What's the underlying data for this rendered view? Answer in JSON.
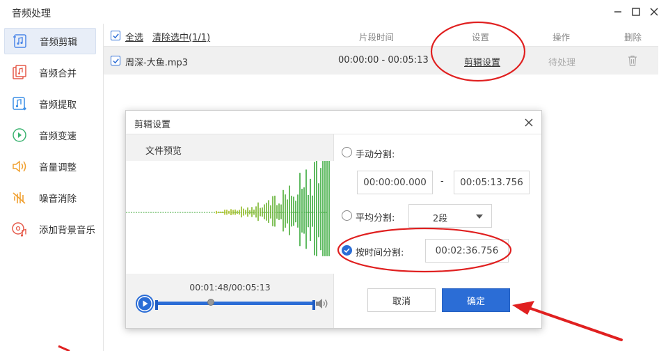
{
  "window": {
    "title": "音频处理"
  },
  "sidebar": {
    "items": [
      {
        "label": "音频剪辑",
        "icon": "audio-cut-icon",
        "active": true
      },
      {
        "label": "音频合并",
        "icon": "audio-merge-icon"
      },
      {
        "label": "音频提取",
        "icon": "audio-extract-icon"
      },
      {
        "label": "音频变速",
        "icon": "audio-speed-icon"
      },
      {
        "label": "音量调整",
        "icon": "volume-adjust-icon"
      },
      {
        "label": "噪音消除",
        "icon": "noise-remove-icon"
      },
      {
        "label": "添加背景音乐",
        "icon": "add-bgm-icon"
      }
    ]
  },
  "table": {
    "select_all": "全选",
    "clear_selected": "清除选中(1/1)",
    "col_segment_time": "片段时间",
    "col_settings": "设置",
    "col_action": "操作",
    "col_delete": "删除",
    "row": {
      "file": "周深-大鱼.mp3",
      "segment_time": "00:00:00 - 00:05:13",
      "settings_link": "剪辑设置",
      "status": "待处理"
    }
  },
  "dialog": {
    "title": "剪辑设置",
    "preview_label": "文件预览",
    "playback_time": "00:01:48/00:05:13",
    "progress_fraction": 0.34,
    "options": {
      "manual_label": "手动分割:",
      "manual_start": "00:00:00.000",
      "range_separator": "-",
      "manual_end": "00:05:13.756",
      "average_label": "平均分割:",
      "average_value": "2段",
      "by_time_label": "按时间分割:",
      "by_time_value": "00:02:36.756"
    },
    "cancel_label": "取消",
    "ok_label": "确定"
  },
  "colors": {
    "accent": "#2b6dd6",
    "annotation_red": "#e02020",
    "wave_green": "#3fa83a",
    "wave_yellow": "#b9c21b"
  }
}
